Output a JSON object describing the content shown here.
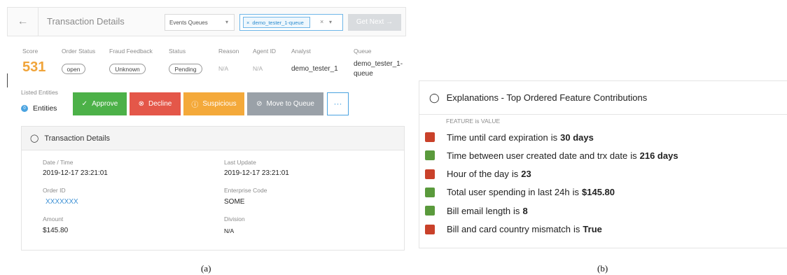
{
  "panel_a": {
    "header": {
      "back_icon": "arrow-left-icon",
      "title": "Transaction Details",
      "queue_type": "Events Queues",
      "queue_tag": "demo_tester_1-queue",
      "get_next": "Get Next →"
    },
    "info": {
      "score_label": "Score",
      "score": "531",
      "order_status_label": "Order Status",
      "order_status": "open",
      "fraud_feedback_label": "Fraud Feedback",
      "fraud_feedback": "Unknown",
      "status_label": "Status",
      "status": "Pending",
      "reason_label": "Reason",
      "reason": "N/A",
      "agent_id_label": "Agent ID",
      "agent_id": "N/A",
      "analyst_label": "Analyst",
      "analyst": "demo_tester_1",
      "queue_label": "Queue",
      "queue_line1": "demo_tester_1-",
      "queue_line2": "queue"
    },
    "entities": {
      "listed_label": "Listed Entities",
      "count": "0",
      "label": "Entities"
    },
    "actions": {
      "approve": "Approve",
      "decline": "Decline",
      "suspicious": "Suspicious",
      "move_to_queue": "Move to Queue",
      "more": "···"
    },
    "details": {
      "title": "Transaction Details",
      "date_time_label": "Date / Time",
      "date_time": "2019-12-17 23:21:01",
      "last_update_label": "Last Update",
      "last_update": "2019-12-17 23:21:01",
      "order_id_label": "Order ID",
      "order_id": "XXXXXXX",
      "enterprise_code_label": "Enterprise Code",
      "enterprise_code": "SOME",
      "amount_label": "Amount",
      "amount": "$145.80",
      "division_label": "Division",
      "division": "N/A"
    },
    "caption": "(a)"
  },
  "panel_b": {
    "title": "Explanations - Top Ordered Feature Contributions",
    "legend_note": "FEATURE is VALUE",
    "connector": "is",
    "colors": {
      "red": "#c9412a",
      "green": "#5a9a3c"
    },
    "features": [
      {
        "name": "Time until card expiration",
        "value": "30 days",
        "color": "red"
      },
      {
        "name": "Time between user created date and trx date",
        "value": "216 days",
        "color": "green"
      },
      {
        "name": "Hour of the day",
        "value": "23",
        "color": "red"
      },
      {
        "name": "Total user spending in last 24h",
        "value": "$145.80",
        "color": "green"
      },
      {
        "name": "Bill email length",
        "value": "8",
        "color": "green"
      },
      {
        "name": "Bill and card country mismatch",
        "value": "True",
        "color": "red"
      }
    ],
    "caption": "(b)"
  }
}
